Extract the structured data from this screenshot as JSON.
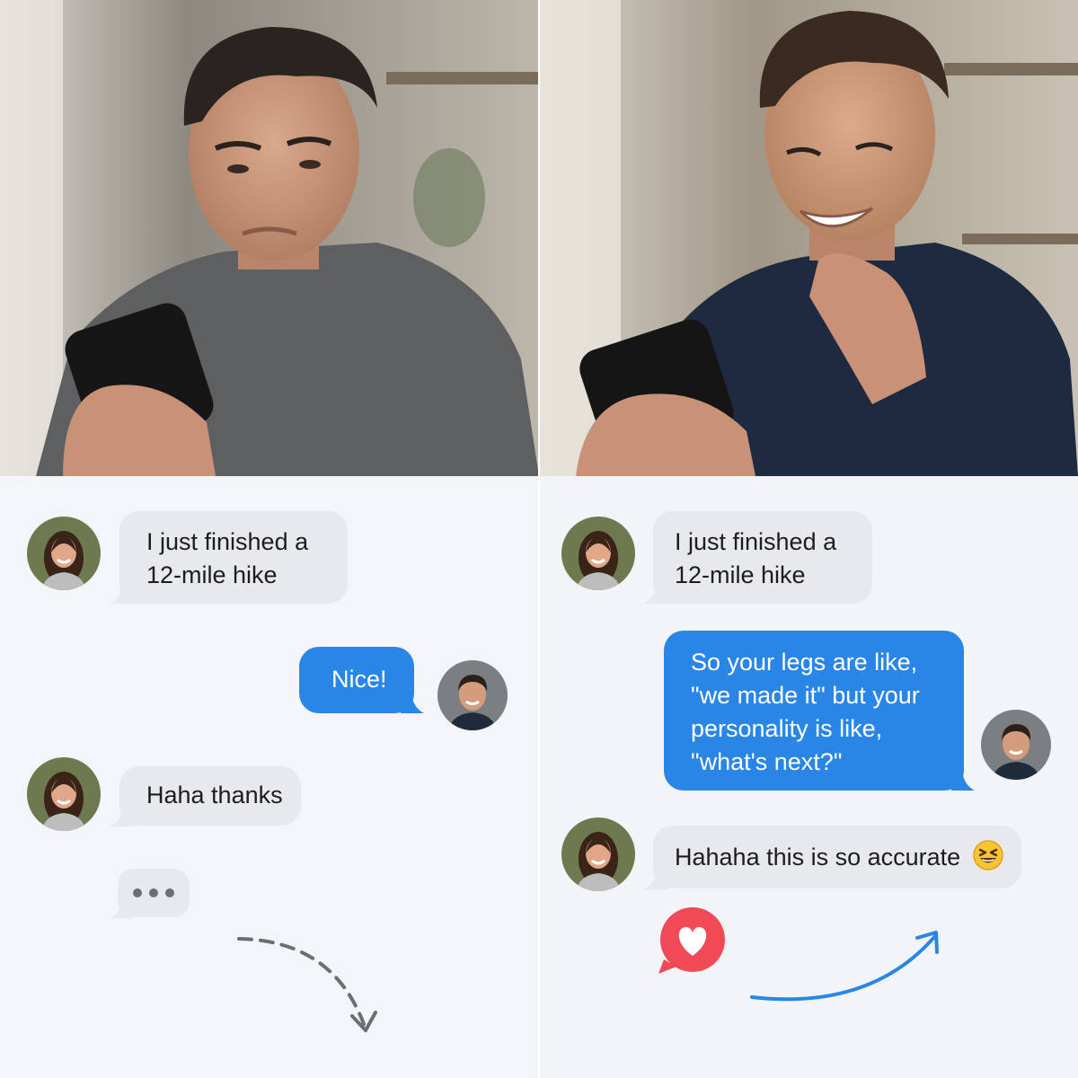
{
  "before": {
    "messages": [
      {
        "from": "her",
        "lines": [
          "I just finished a",
          "12-mile hike"
        ]
      },
      {
        "from": "him",
        "lines": [
          "Nice!"
        ]
      },
      {
        "from": "her",
        "lines": [
          "Haha thanks"
        ]
      }
    ],
    "typing_indicator": "typing-dots",
    "arrow_style": "dashed, curving down"
  },
  "after": {
    "messages": [
      {
        "from": "her",
        "lines": [
          "I just finished a",
          "12-mile hike"
        ]
      },
      {
        "from": "him",
        "lines": [
          "So your legs are like,",
          "\"we made it\" but your",
          "personality is like,",
          "\"what's next?\""
        ]
      },
      {
        "from": "her",
        "lines": [
          "Hahaha this is so accurate"
        ]
      }
    ],
    "reaction_icon": "heart-reaction",
    "emoji": "grinning-squinting-face",
    "arrow_style": "solid, curving up"
  },
  "colors": {
    "incoming_bubble": "#e8e9ec",
    "outgoing_bubble": "#2a86e6",
    "reaction": "#ef4a55",
    "arrow_up": "#2a86e6",
    "arrow_down": "#6b6e74"
  }
}
